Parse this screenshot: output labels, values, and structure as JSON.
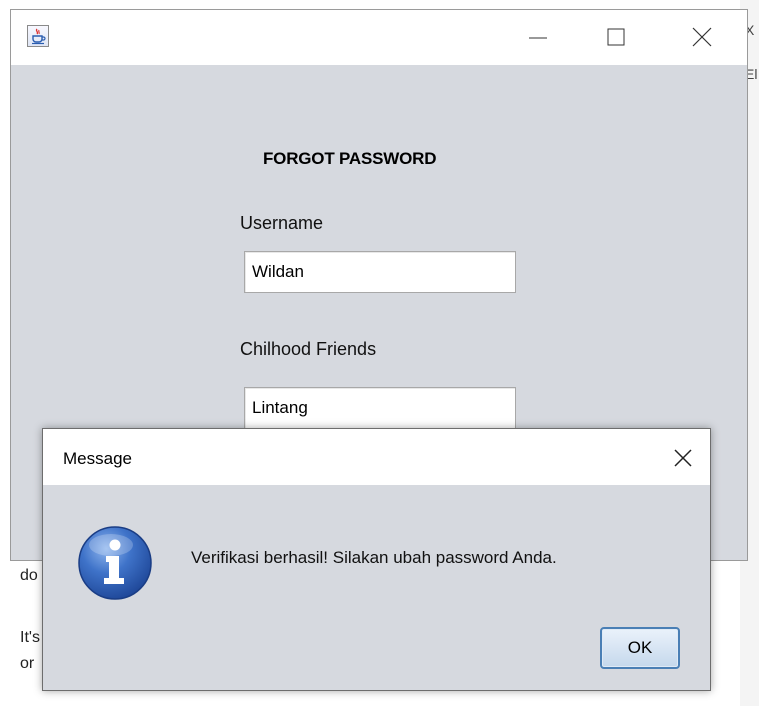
{
  "window": {
    "title": "",
    "app_icon": "java-coffee-cup-icon",
    "controls": [
      "minimize-icon",
      "maximize-icon",
      "close-icon"
    ]
  },
  "form": {
    "title": "FORGOT PASSWORD",
    "username_label": "Username",
    "username_value": "Wildan",
    "friends_label": "Chilhood Friends",
    "friends_value": "Lintang"
  },
  "dialog": {
    "title": "Message",
    "icon": "information-icon",
    "message": "Verifikasi berhasil! Silakan ubah password Anda.",
    "ok_label": "OK"
  },
  "background": {
    "right_edge_glyphs": [
      "X",
      "El"
    ],
    "left_text_lines": [
      "do",
      "It's",
      "or"
    ]
  },
  "colors": {
    "window_bg": "#d6d9df",
    "titlebar_bg": "#ffffff",
    "info_blue": "#2a5db0",
    "ok_border": "#4a7fb5"
  }
}
